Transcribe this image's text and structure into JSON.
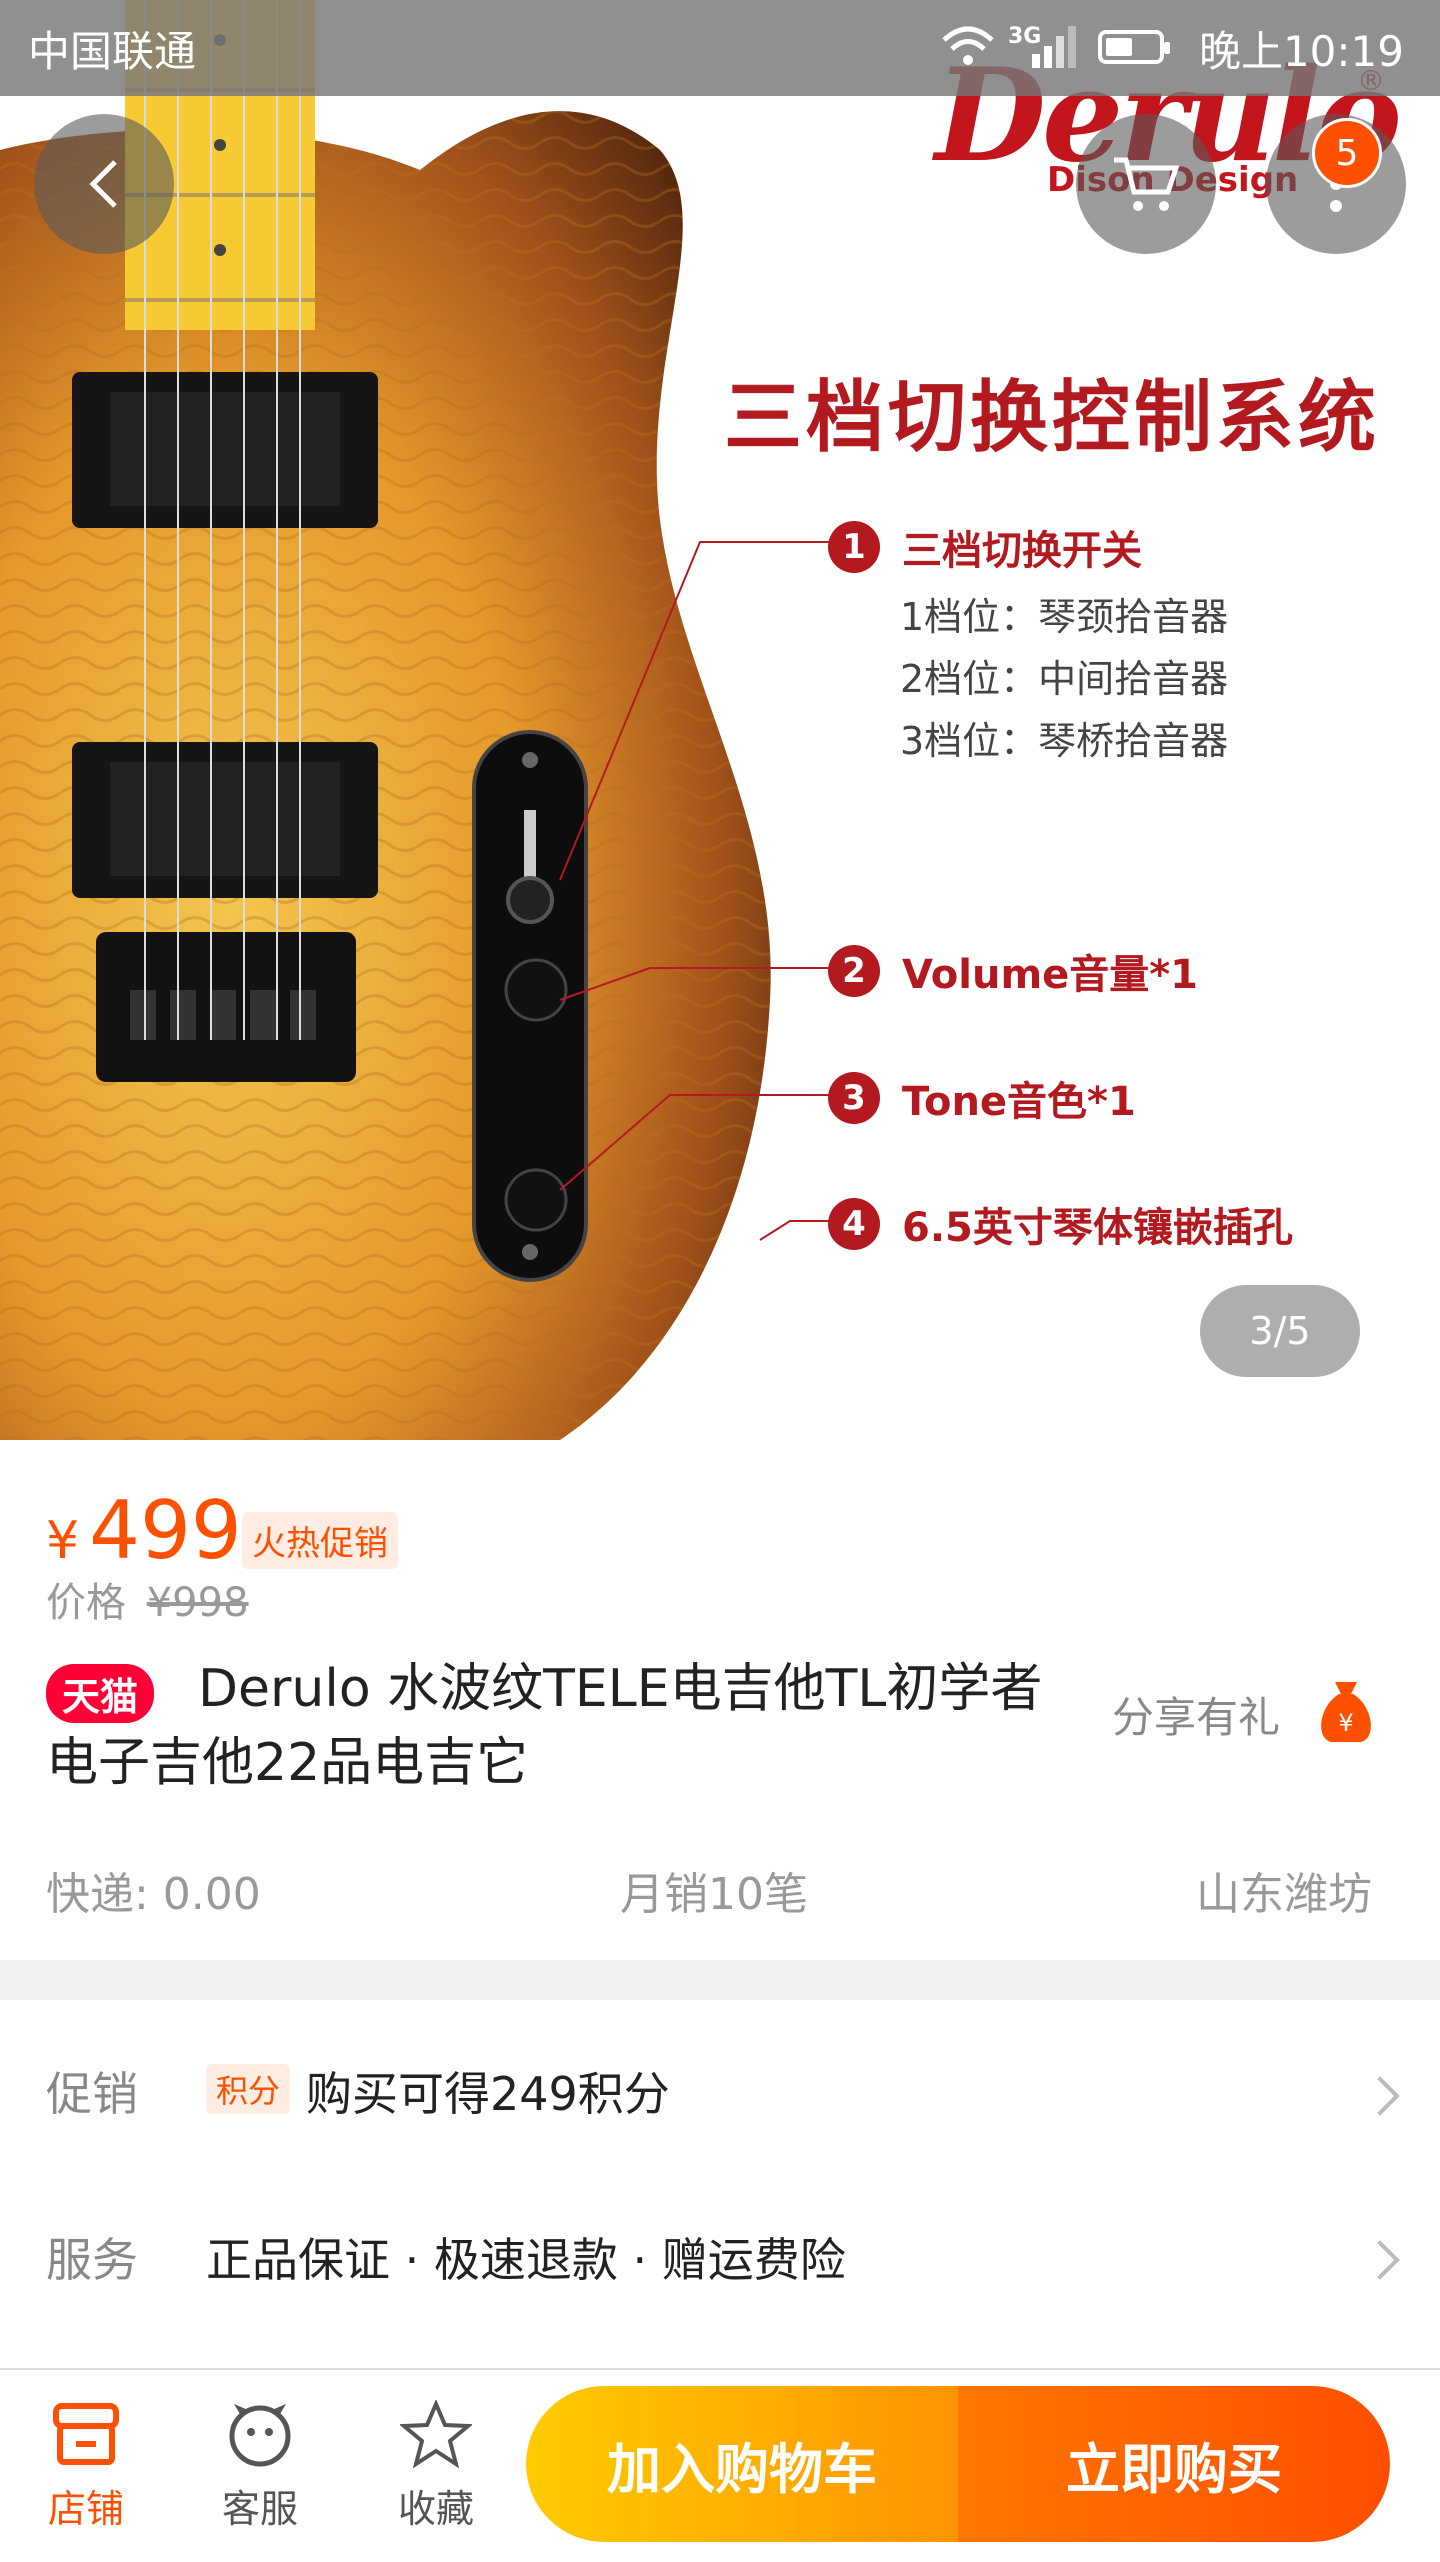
{
  "status_bar": {
    "carrier": "中国联通",
    "network": "3G",
    "time": "晚上10:19"
  },
  "hero": {
    "brand_name": "Derulo",
    "brand_sub": "Dison Design",
    "brand_reg": "®",
    "heading": "三档切换控制系统",
    "features": [
      {
        "num": "1",
        "text": "三档切换开关"
      },
      {
        "num": "2",
        "text": "Volume音量*1"
      },
      {
        "num": "3",
        "text": "Tone音色*1"
      },
      {
        "num": "4",
        "text": "6.5英寸琴体镶嵌插孔"
      }
    ],
    "switch_positions": [
      "1档位：琴颈拾音器",
      "2档位：中间拾音器",
      "3档位：琴桥拾音器"
    ],
    "cart_badge": "5",
    "page_indicator": "3/5",
    "icons": {
      "back": "back-arrow-icon",
      "cart": "cart-icon",
      "more": "more-vertical-icon"
    }
  },
  "product": {
    "currency": "¥",
    "price": "499",
    "promo_tag": "火热促销",
    "original_label": "价格",
    "original_price": "¥998",
    "tmall": "天猫",
    "title": "Derulo 水波纹TELE电吉他TL初学者电子吉他22品电吉它",
    "share": "分享有礼",
    "shipping": "快递: 0.00",
    "monthly_sales": "月销10笔",
    "location": "山东潍坊"
  },
  "rows": {
    "promo_label": "促销",
    "promo_tag": "积分",
    "promo_text": "购买可得249积分",
    "service_label": "服务",
    "service_text": "正品保证 · 极速退款 · 赠运费险"
  },
  "bottom_bar": {
    "store": "店铺",
    "service": "客服",
    "favorite": "收藏",
    "add_to_cart": "加入购物车",
    "buy_now": "立即购买"
  },
  "colors": {
    "accent": "#ff5000",
    "tmall": "#ff0036",
    "feature_red": "#b31a1f"
  }
}
